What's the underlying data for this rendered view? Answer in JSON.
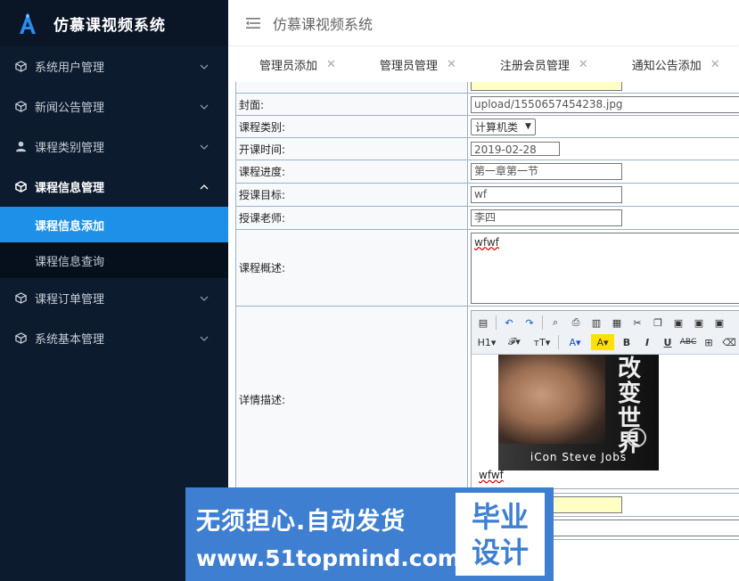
{
  "app": {
    "title": "仿慕课视频系统"
  },
  "header": {
    "title": "仿慕课视频系统"
  },
  "sidebar": {
    "items": [
      {
        "label": "系统用户管理",
        "icon": "cube-icon"
      },
      {
        "label": "新闻公告管理",
        "icon": "cube-icon"
      },
      {
        "label": "课程类别管理",
        "icon": "user-icon"
      },
      {
        "label": "课程信息管理",
        "icon": "cube-icon"
      },
      {
        "label": "课程订单管理",
        "icon": "cube-icon"
      },
      {
        "label": "系统基本管理",
        "icon": "cube-icon"
      }
    ],
    "sub_items": [
      {
        "label": "课程信息添加"
      },
      {
        "label": "课程信息查询"
      }
    ]
  },
  "tabs": [
    {
      "label": "管理员添加"
    },
    {
      "label": "管理员管理"
    },
    {
      "label": "注册会员管理"
    },
    {
      "label": "通知公告添加"
    },
    {
      "label": "通"
    }
  ],
  "form": {
    "cover_label": "封面:",
    "cover_value": "upload/1550657454238.jpg",
    "category_label": "课程类别:",
    "category_value": "计算机类",
    "start_label": "开课时间:",
    "start_value": "2019-02-28",
    "progress_label": "课程进度:",
    "progress_value": "第一章第一节",
    "goal_label": "授课目标:",
    "goal_value": "wf",
    "teacher_label": "授课老师:",
    "teacher_value": "李四",
    "summary_label": "课程概述:",
    "summary_value": "wfwf",
    "detail_label": "详情描述:",
    "detail_text": "wfwf",
    "book_title_cn": "改变世界",
    "book_title_en": "iCon Steve Jobs"
  },
  "watermark": {
    "line1": "无须担心.自动发货",
    "line2": "www.51topmind.com",
    "badge_top": "毕业",
    "badge_bottom": "设计"
  },
  "colors": {
    "sidebar_bg": "#0d1b2e",
    "active_item": "#1e90e8",
    "watermark_bg": "#3e7fd1"
  }
}
